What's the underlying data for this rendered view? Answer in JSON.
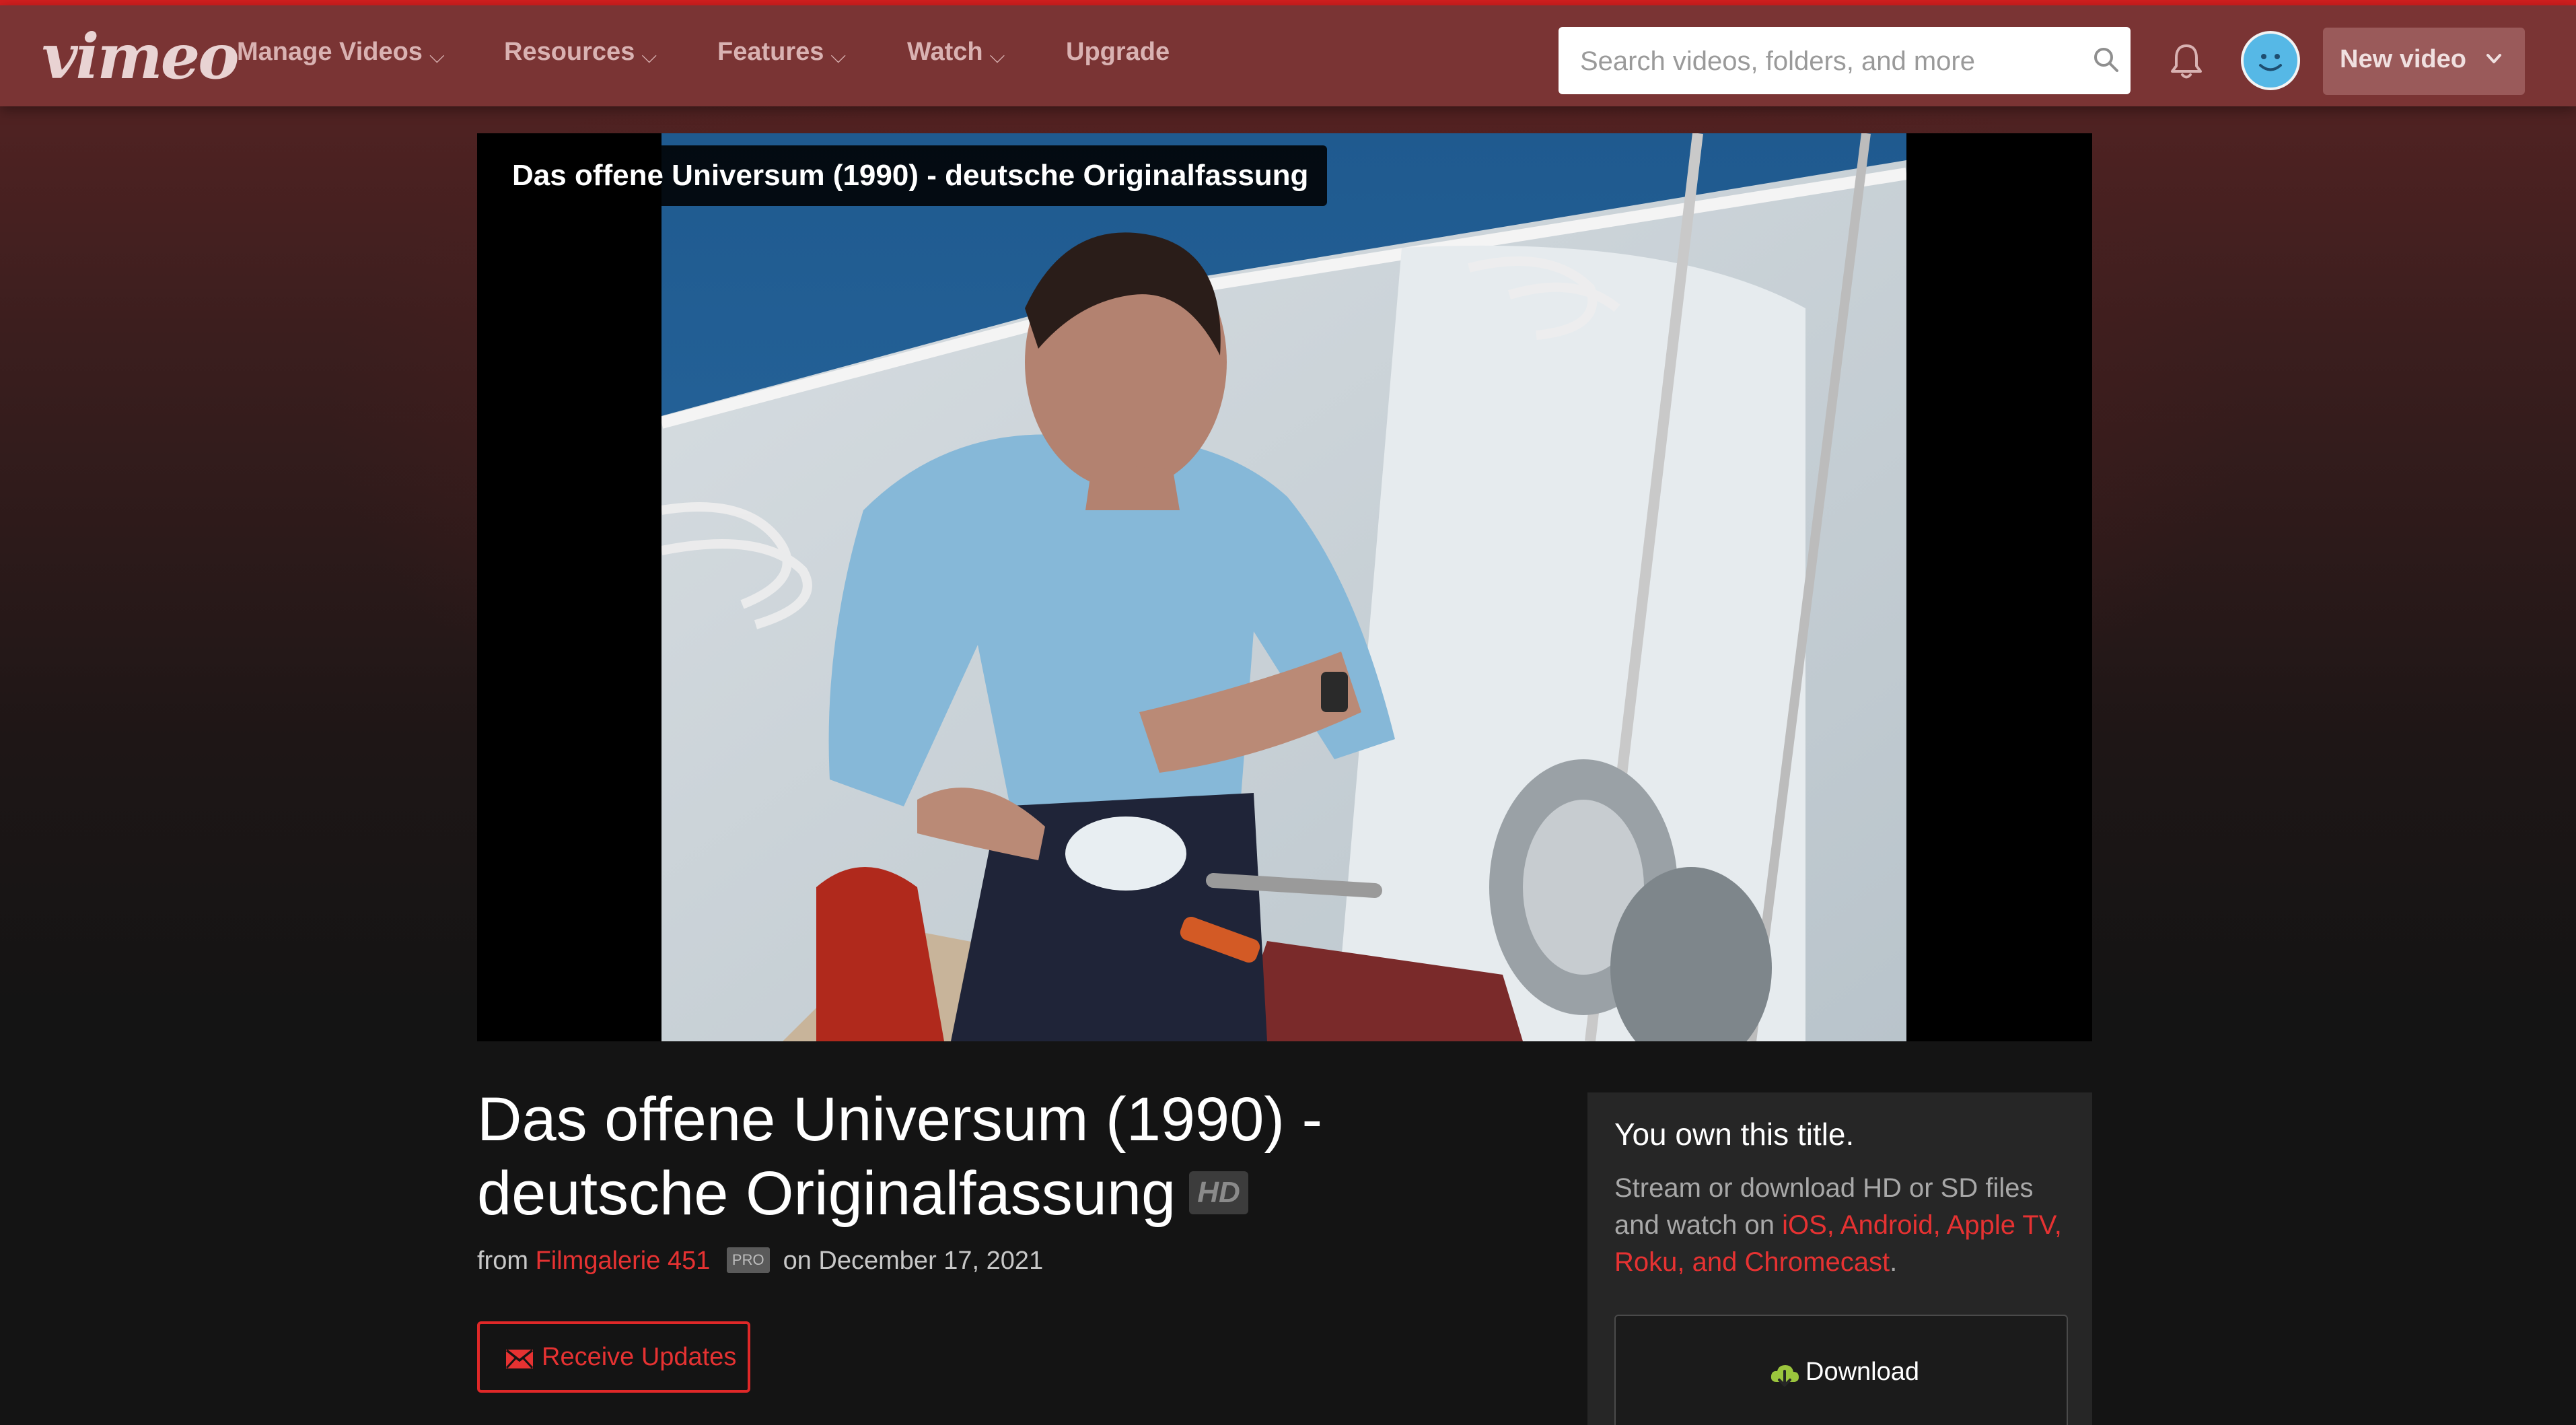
{
  "header": {
    "logo": "vimeo",
    "nav": [
      {
        "label": "Manage Videos",
        "has_chevron": true
      },
      {
        "label": "Resources",
        "has_chevron": true
      },
      {
        "label": "Features",
        "has_chevron": true
      },
      {
        "label": "Watch",
        "has_chevron": true
      },
      {
        "label": "Upgrade",
        "has_chevron": false
      }
    ],
    "chevron_glyph": "⌵",
    "search": {
      "placeholder": "Search videos, folders, and more",
      "value": ""
    },
    "new_video_label": "New video"
  },
  "player": {
    "overlay_title": "Das offene Universum (1990) - deutsche Originalfassung"
  },
  "video": {
    "title_line1": "Das offene Universum (1990) -",
    "title_line2": "deutsche Originalfassung",
    "quality_badge": "HD",
    "from_label": "from",
    "author": "Filmgalerie 451",
    "author_badge": "PRO",
    "date": "on December 17, 2021",
    "receive_updates_label": "Receive Updates"
  },
  "ownership": {
    "heading": "You own this title.",
    "description_prefix": "Stream or download HD or SD files and watch on ",
    "platforms": "iOS, Android, Apple TV, Roku, and Chromecast",
    "description_suffix": ".",
    "download_label": "Download"
  },
  "icons": {
    "search": "search-icon",
    "bell": "bell-icon",
    "avatar": "avatar-icon",
    "mail": "mail-icon",
    "download": "download-cloud-icon"
  },
  "colors": {
    "accent": "#e63232",
    "header_bg": "#7a3434",
    "avatar": "#56b8e6",
    "download_icon": "#9bc53d",
    "top_line": "#d21f1f"
  }
}
